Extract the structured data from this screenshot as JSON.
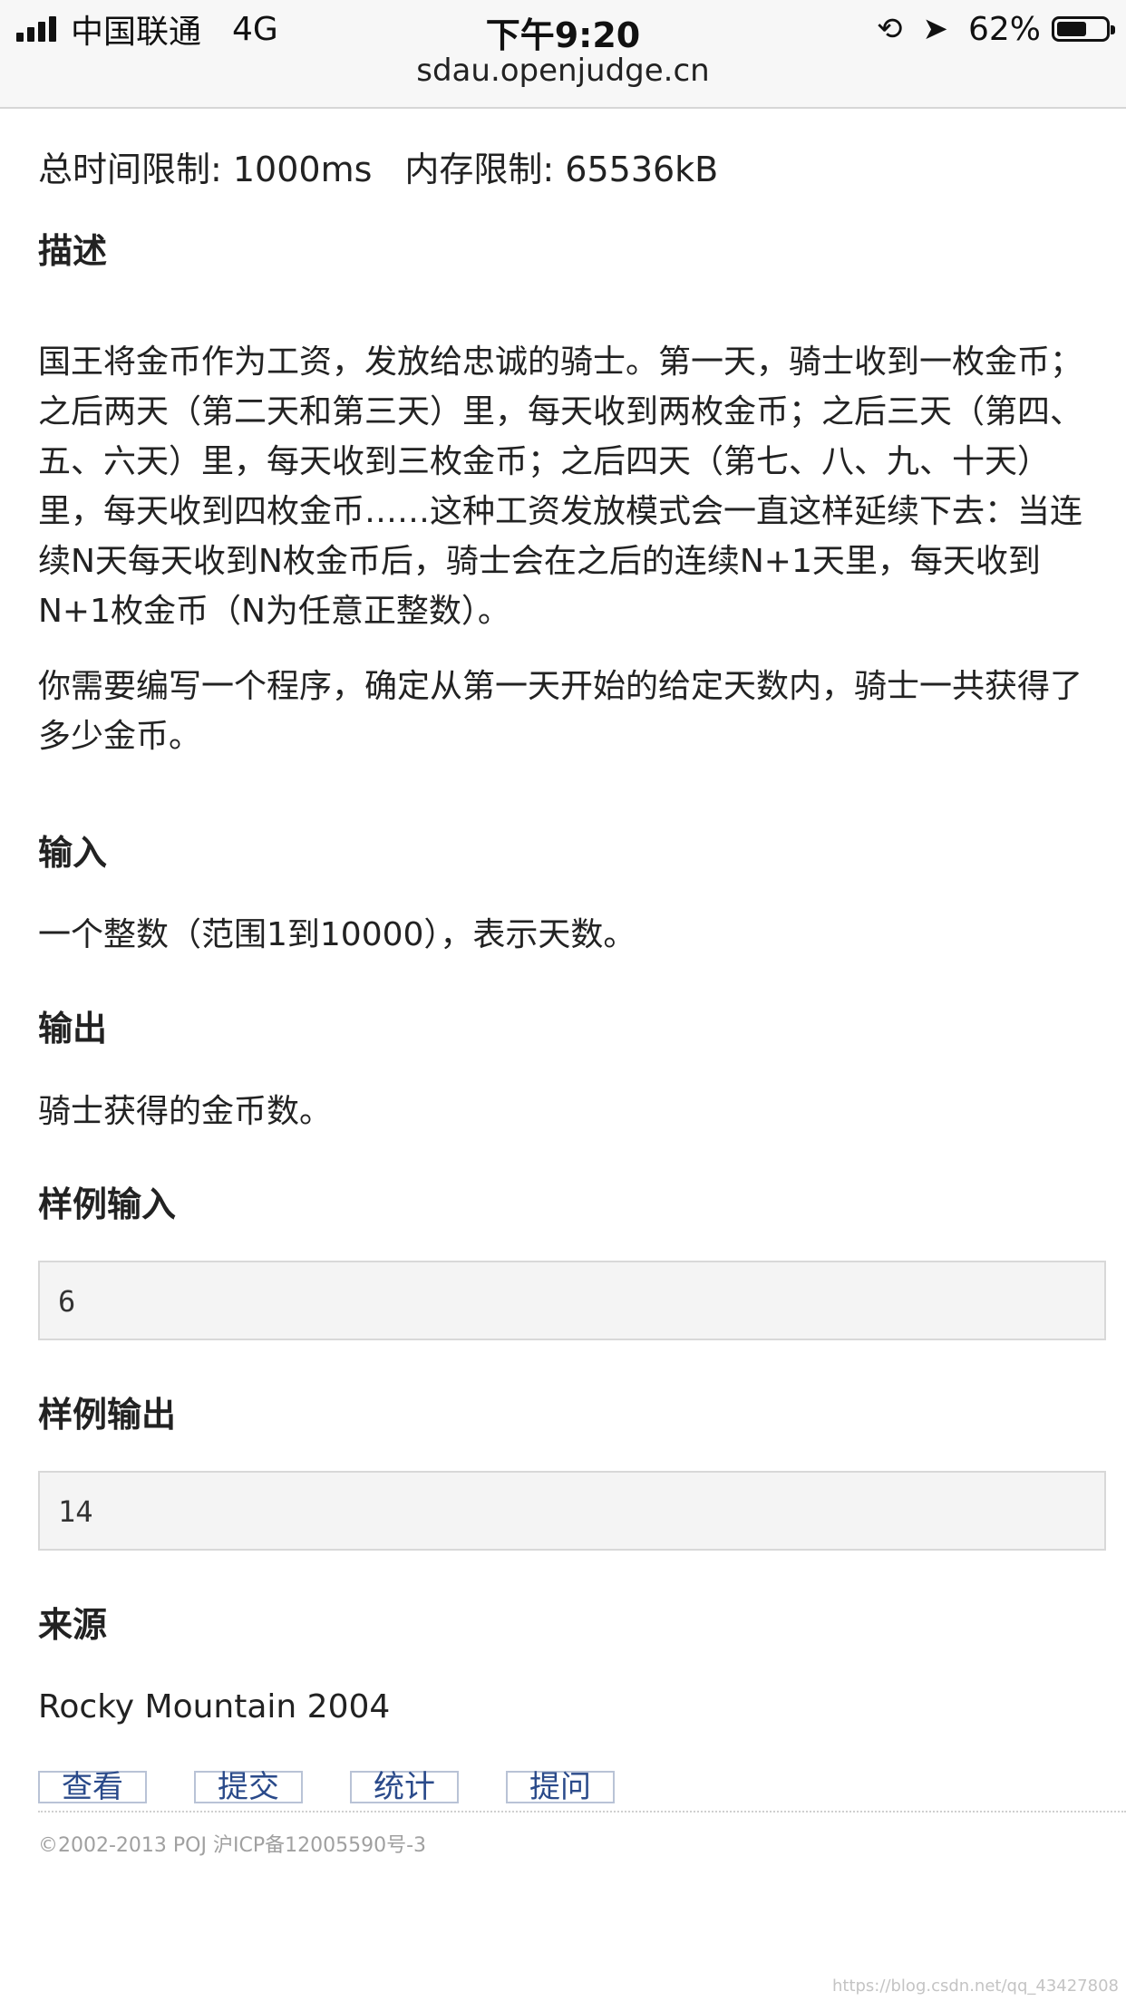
{
  "status_bar": {
    "carrier": "中国联通",
    "network": "4G",
    "time": "下午9:20",
    "battery_text": "62%",
    "battery_level": 0.62
  },
  "url": "sdau.openjudge.cn",
  "limits": {
    "time_label": "总时间限制: 1000ms",
    "memory_label": "内存限制: 65536kB"
  },
  "sections": {
    "description_title": "描述",
    "description_p1": "国王将金币作为工资，发放给忠诚的骑士。第一天，骑士收到一枚金币；之后两天（第二天和第三天）里，每天收到两枚金币；之后三天（第四、五、六天）里，每天收到三枚金币；之后四天（第七、八、九、十天）里，每天收到四枚金币……这种工资发放模式会一直这样延续下去：当连续N天每天收到N枚金币后，骑士会在之后的连续N+1天里，每天收到N+1枚金币（N为任意正整数）。",
    "description_p2": "你需要编写一个程序，确定从第一天开始的给定天数内，骑士一共获得了多少金币。",
    "input_title": "输入",
    "input_text": "一个整数（范围1到10000），表示天数。",
    "output_title": "输出",
    "output_text": "骑士获得的金币数。",
    "sample_input_title": "样例输入",
    "sample_input": "6",
    "sample_output_title": "样例输出",
    "sample_output": "14",
    "source_title": "来源",
    "source_text": "Rocky Mountain 2004"
  },
  "actions": {
    "view": "查看",
    "submit": "提交",
    "stats": "统计",
    "ask": "提问"
  },
  "footer": "©2002-2013 POJ 沪ICP备12005590号-3",
  "watermark": "https://blog.csdn.net/qq_43427808"
}
